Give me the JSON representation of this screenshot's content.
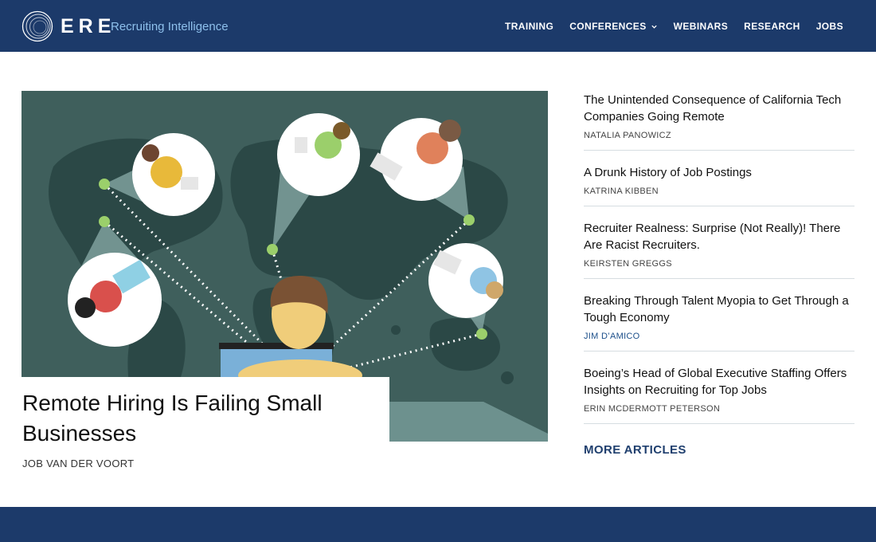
{
  "brand": {
    "name": "ERE",
    "tagline": "Recruiting Intelligence",
    "logo_icon": "concentric-circles-icon"
  },
  "nav": {
    "items": [
      {
        "label": "TRAINING"
      },
      {
        "label": "CONFERENCES",
        "has_dropdown": true
      },
      {
        "label": "WEBINARS"
      },
      {
        "label": "RESEARCH"
      },
      {
        "label": "JOBS"
      }
    ]
  },
  "featured": {
    "title": "Remote Hiring Is Failing Small Businesses",
    "author": "JOB VAN DER VOORT"
  },
  "articles": [
    {
      "title": "The Unintended Consequence of California Tech Companies Going Remote",
      "author": "NATALIA PANOWICZ"
    },
    {
      "title": "A Drunk History of Job Postings",
      "author": "KATRINA KIBBEN"
    },
    {
      "title": "Recruiter Realness: Surprise (Not Really)! There Are Racist Recruiters.",
      "author": "KEIRSTEN GREGGS"
    },
    {
      "title": "Breaking Through Talent Myopia to Get Through a Tough Economy",
      "author": "JIM D’AMICO"
    },
    {
      "title": "Boeing’s Head of Global Executive Staffing Offers Insights on Recruiting for Top Jobs",
      "author": "ERIN MCDERMOTT PETERSON"
    }
  ],
  "more_label": "MORE ARTICLES",
  "colors": {
    "header_bg": "#1c3a6a",
    "tagline": "#8ec0ec",
    "hero_bg": "#3f5f5c",
    "accent_author": "#1c4f8a"
  }
}
